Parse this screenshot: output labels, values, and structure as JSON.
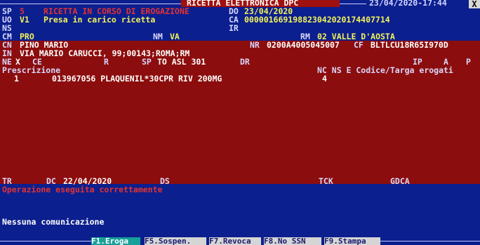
{
  "title": {
    "center": "RICETTA ELETTRONICA DPC",
    "datetime": "23/04/2020-17:44",
    "close": "X"
  },
  "header": {
    "sp_label": "SP",
    "sp_value": "5",
    "status": "RICETTA IN CORSO DI EROGAZIONE",
    "do_label": "DO",
    "do_value": "23/04/2020",
    "uo_label": "UO",
    "uo_value": "V1",
    "uo_desc": "Presa in carico ricetta",
    "ca_label": "CA",
    "ca_value": "000001669198823042020174407714",
    "ns_label": "NS",
    "ir_label": "IR",
    "cm_label": "CM",
    "cm_value": "PRO",
    "nm_label": "NM",
    "nm_value": "VA",
    "rm_label": "RM",
    "rm_value": "02 VALLE D'AOSTA"
  },
  "patient": {
    "cn_label": "CN",
    "cn_value": "PINO MARIO",
    "nr_label": "NR",
    "nr_value": "0200A4005045007",
    "cf_label": "CF",
    "cf_value": "BLTLCU18R65I970D",
    "in_label": "IN",
    "in_value": "VIA MARIO CARUCCI, 99;00143;ROMA;RM",
    "ne_label": "NE",
    "ne_value": "X",
    "ce_label": "CE",
    "r_label": "R",
    "sp_label": "SP",
    "sp_value": "TO ASL 301",
    "dr_label": "DR",
    "ip_label": "IP",
    "a_label": "A",
    "p_label": "P"
  },
  "table": {
    "prescrizione_header": "Prescrizione",
    "right_header": "NC NS E Codice/Targa erogati",
    "rows": [
      {
        "index": "1",
        "text": "013967056 PLAQUENIL*30CPR RIV 200MG",
        "ns": "4"
      }
    ]
  },
  "footer": {
    "tr_label": "TR",
    "dc_label": "DC",
    "dc_value": "22/04/2020",
    "ds_label": "DS",
    "tck_label": "TCK",
    "gdca_label": "GDCA",
    "message": "Operazione eseguita correttamente",
    "communication": "Nessuna comunicazione"
  },
  "fkeys": [
    {
      "label": "F1.Eroga"
    },
    {
      "label": "F5.Sospen."
    },
    {
      "label": "F7.Revoca"
    },
    {
      "label": "F8.No SSN"
    },
    {
      "label": "F9.Stampa"
    }
  ],
  "colors": {
    "background": "#0c1f8e",
    "panel": "#8c0d0d",
    "status_red": "#e33232",
    "value_yellow": "#f3f35a",
    "active_fkey": "#16a09a"
  }
}
